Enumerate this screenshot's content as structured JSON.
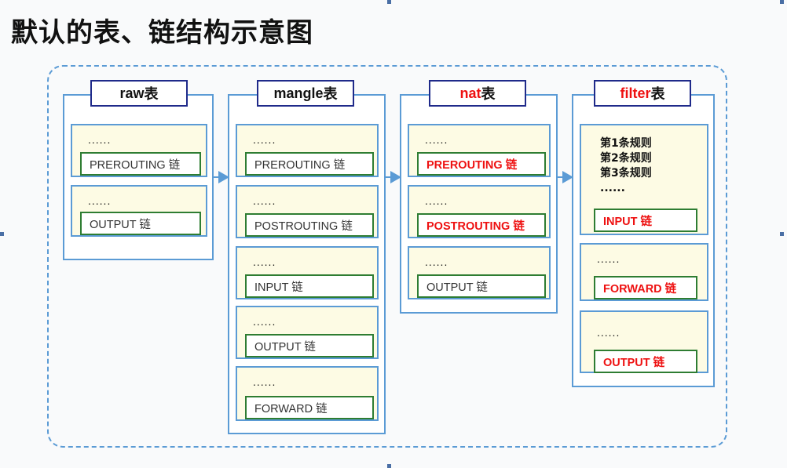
{
  "title": "默认的表、链结构示意图",
  "tables": [
    {
      "prefix": "raw",
      "suffix": " 表",
      "red": false,
      "chains": [
        {
          "dots": "......",
          "label": "PREROUTING 链",
          "red": false
        },
        {
          "dots": "......",
          "label": "OUTPUT 链",
          "red": false
        }
      ]
    },
    {
      "prefix": "mangle",
      "suffix": " 表",
      "red": false,
      "chains": [
        {
          "dots": "......",
          "label": "PREROUTING 链",
          "red": false
        },
        {
          "dots": "......",
          "label": "POSTROUTING 链",
          "red": false
        },
        {
          "dots": "......",
          "label": "INPUT 链",
          "red": false
        },
        {
          "dots": "......",
          "label": "OUTPUT 链",
          "red": false
        },
        {
          "dots": "......",
          "label": "FORWARD 链",
          "red": false
        }
      ]
    },
    {
      "prefix": "nat",
      "suffix": " 表",
      "red": true,
      "chains": [
        {
          "dots": "......",
          "label": "PREROUTING 链",
          "red": true
        },
        {
          "dots": "......",
          "label": "POSTROUTING 链",
          "red": true
        },
        {
          "dots": "......",
          "label": "OUTPUT 链",
          "red": false
        }
      ]
    },
    {
      "prefix": "filter",
      "suffix": " 表",
      "red": true,
      "chains": [
        {
          "rules": [
            "第1条规则",
            "第2条规则",
            "第3条规则",
            "......"
          ],
          "label": "INPUT 链",
          "red": true
        },
        {
          "dots": "......",
          "label": "FORWARD 链",
          "red": true
        },
        {
          "dots": "......",
          "label": "OUTPUT 链",
          "red": true
        }
      ]
    }
  ],
  "colors": {
    "panel_border": "#5b9bd5",
    "label_border": "#1f2a8a",
    "chain_border": "#2e7d32",
    "chain_fill": "#fdfbe4",
    "accent_red": "#e11111"
  }
}
